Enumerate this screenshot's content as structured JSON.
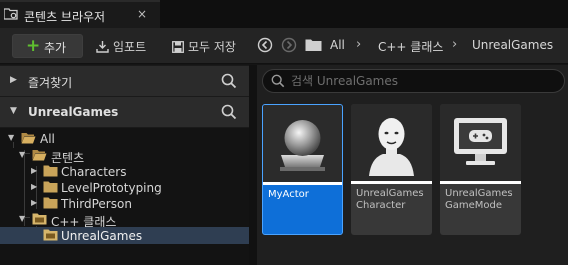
{
  "tab": {
    "title": "콘텐츠 브라우저",
    "close": "×"
  },
  "toolbar": {
    "add_label": "추가",
    "import_label": "임포트",
    "saveall_label": "모두 저장",
    "breadcrumb": [
      "All",
      "C++ 클래스",
      "UnrealGames"
    ],
    "breadcrumb_sep": "›"
  },
  "favorites": {
    "label": "즐겨찾기"
  },
  "project": {
    "label": "UnrealGames"
  },
  "tree": [
    {
      "label": "All"
    },
    {
      "label": "콘텐츠"
    },
    {
      "label": "Characters"
    },
    {
      "label": "LevelPrototyping"
    },
    {
      "label": "ThirdPerson"
    },
    {
      "label": "C++ 클래스"
    },
    {
      "label": "UnrealGames",
      "selected": true
    }
  ],
  "search": {
    "placeholder": "검색 UnrealGames"
  },
  "assets": [
    {
      "caption": "MyActor",
      "icon": "sphere-actor-icon",
      "selected": true
    },
    {
      "caption": "UnrealGames\nCharacter",
      "icon": "character-mannequin-icon"
    },
    {
      "caption": "UnrealGames\nGameMode",
      "icon": "gamemode-monitor-icon"
    }
  ],
  "colors": {
    "accent": "#0e6fd8",
    "add_plus": "#5fbf2f",
    "folder": "#c9a45a",
    "cpp_folder": "#d6b56b"
  }
}
